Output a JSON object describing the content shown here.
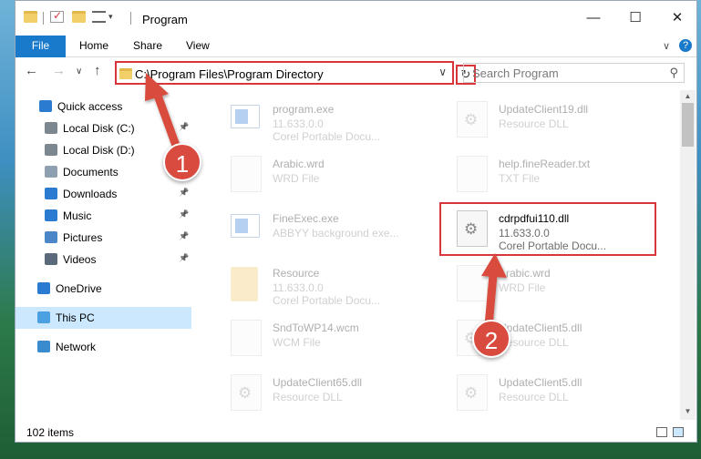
{
  "window": {
    "title": "Program",
    "controls": {
      "minimize": "—",
      "maximize": "☐",
      "close": "✕"
    }
  },
  "ribbon": {
    "tabs": [
      "File",
      "Home",
      "Share",
      "View"
    ],
    "expand": "∨",
    "help": "?"
  },
  "nav": {
    "back": "←",
    "forward": "→",
    "recent": "∨",
    "up": "↑",
    "address": "C:\\Program Files\\Program Directory",
    "refresh": "↻",
    "search_placeholder": "Search Program",
    "search_glyph": "⚲"
  },
  "sidebar": {
    "items": [
      {
        "label": "Quick access",
        "icon": "star-icon",
        "pinned": false
      },
      {
        "label": "Local Disk (C:)",
        "icon": "drive-icon",
        "pinned": true
      },
      {
        "label": "Local Disk (D:)",
        "icon": "drive-icon",
        "pinned": false
      },
      {
        "label": "Documents",
        "icon": "document-icon",
        "pinned": true
      },
      {
        "label": "Downloads",
        "icon": "download-icon",
        "pinned": true
      },
      {
        "label": "Music",
        "icon": "music-icon",
        "pinned": true
      },
      {
        "label": "Pictures",
        "icon": "picture-icon",
        "pinned": true
      },
      {
        "label": "Videos",
        "icon": "video-icon",
        "pinned": true
      },
      {
        "label": "OneDrive",
        "icon": "cloud-icon",
        "pinned": false
      },
      {
        "label": "This PC",
        "icon": "computer-icon",
        "pinned": false,
        "selected": true
      },
      {
        "label": "Network",
        "icon": "network-icon",
        "pinned": false
      }
    ],
    "pin_glyph": "📌"
  },
  "files": [
    {
      "name": "program.exe",
      "line2": "11.633.0.0",
      "line3": "Corel Portable Docu...",
      "icon": "exe-icon"
    },
    {
      "name": "UpdateClient19.dll",
      "line2": "Resource DLL",
      "line3": "",
      "icon": "dll-icon"
    },
    {
      "name": "Arabic.wrd",
      "line2": "WRD File",
      "line3": "",
      "icon": "file-icon"
    },
    {
      "name": "help.fineReader.txt",
      "line2": "TXT File",
      "line3": "",
      "icon": "file-icon"
    },
    {
      "name": "FineExec.exe",
      "line2": "ABBYY background exe...",
      "line3": "",
      "icon": "app-icon"
    },
    {
      "name": "cdrpdfui110.dll",
      "line2": "11.633.0.0",
      "line3": "Corel Portable Docu...",
      "icon": "dll-icon",
      "highlighted": true
    },
    {
      "name": "Resource",
      "line2": "11.633.0.0",
      "line3": "Corel Portable Docu...",
      "icon": "folder-icon"
    },
    {
      "name": "Arabic.wrd",
      "line2": "WRD File",
      "line3": "",
      "icon": "file-icon"
    },
    {
      "name": "SndToWP14.wcm",
      "line2": "WCM File",
      "line3": "",
      "icon": "file-icon"
    },
    {
      "name": "UpdateClient5.dll",
      "line2": "Resource DLL",
      "line3": "",
      "icon": "dll-icon"
    },
    {
      "name": "UpdateClient65.dll",
      "line2": "Resource DLL",
      "line3": "",
      "icon": "dll-icon"
    },
    {
      "name": "UpdateClient5.dll",
      "line2": "Resource DLL",
      "line3": "",
      "icon": "dll-icon"
    }
  ],
  "status": {
    "items": "102 items"
  },
  "annotations": {
    "step1": "1",
    "step2": "2",
    "accent": "#d9363c"
  },
  "colors": {
    "file_tab": "#1979ca",
    "selection": "#cce8ff",
    "folder": "#f2c55c"
  }
}
